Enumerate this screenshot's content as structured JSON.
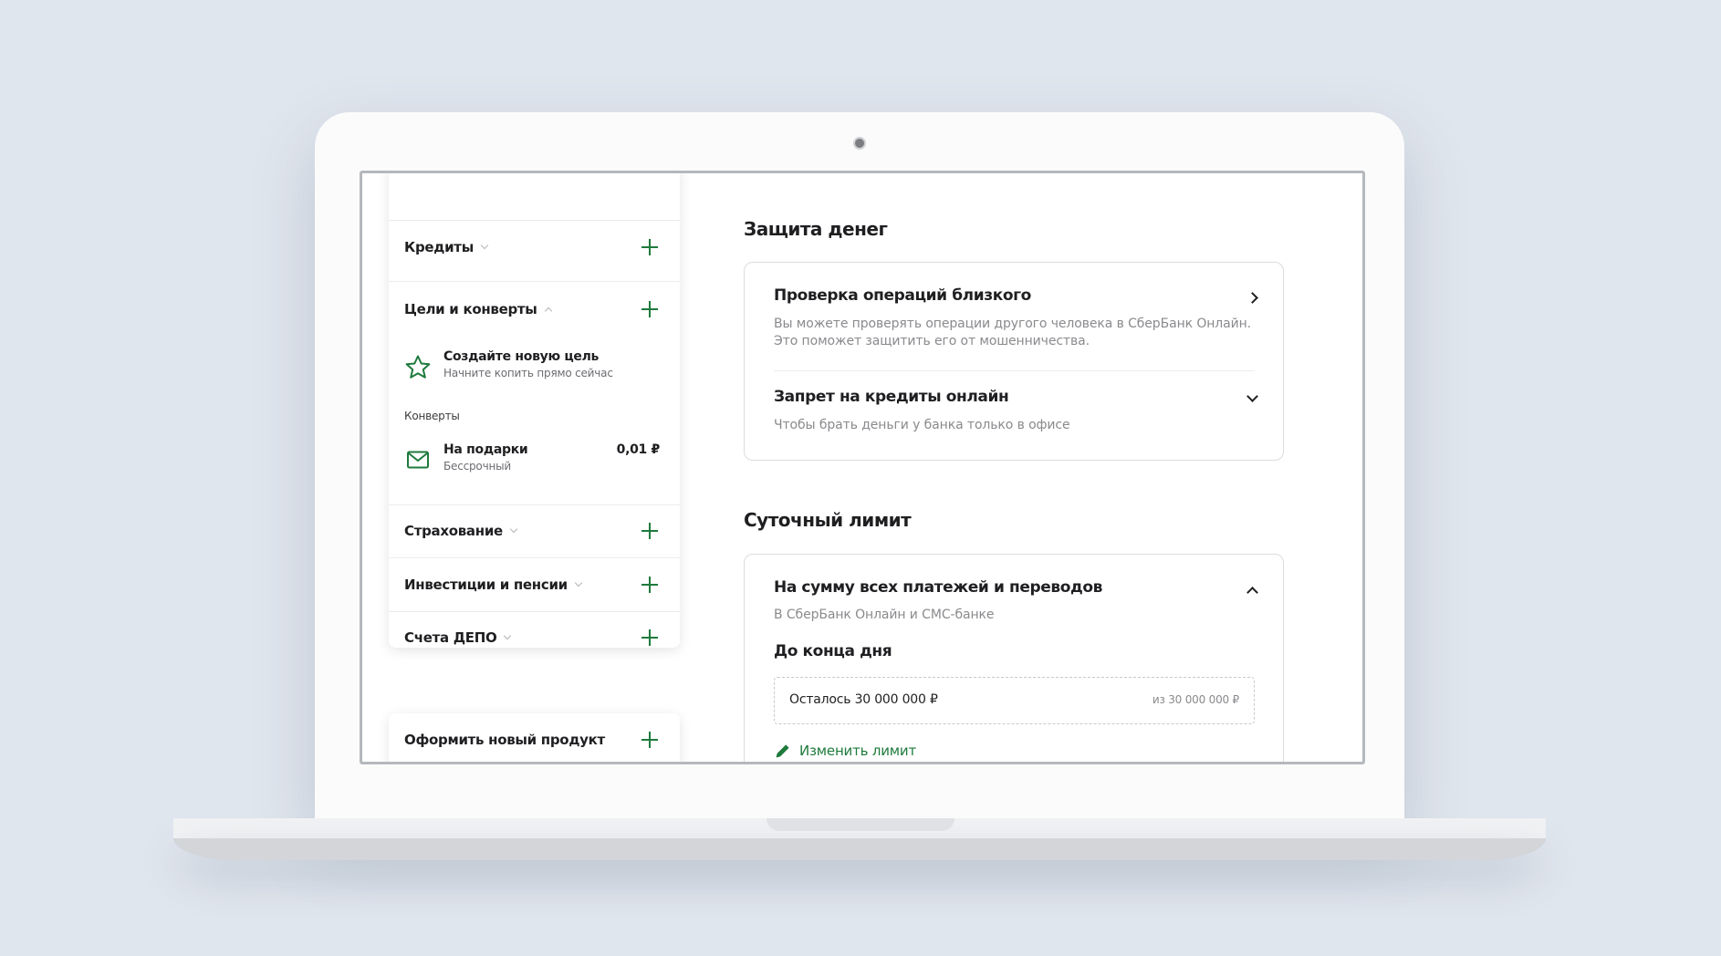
{
  "sidebar": {
    "credits": {
      "label": "Кредиты"
    },
    "goals": {
      "label": "Цели и конверты",
      "new_goal_title": "Создайте новую цель",
      "new_goal_subtitle": "Начните копить прямо сейчас",
      "envelopes_label": "Конверты",
      "envelope": {
        "title": "На подарки",
        "subtitle": "Бессрочный",
        "amount": "0,01 ₽"
      }
    },
    "insurance": {
      "label": "Страхование"
    },
    "investments": {
      "label": "Инвестиции и пенсии"
    },
    "depo": {
      "label": "Счета ДЕПО"
    },
    "new_product": {
      "label": "Оформить новый продукт"
    }
  },
  "protection": {
    "heading": "Защита денег",
    "check": {
      "title": "Проверка операций близкого",
      "description": "Вы можете проверять операции другого человека в СберБанк Онлайн. Это поможет защитить его от мошенничества."
    },
    "credit_ban": {
      "title": "Запрет на кредиты онлайн",
      "description": "Чтобы брать деньги у банка только в офисе"
    }
  },
  "daily_limit": {
    "heading": "Суточный лимит",
    "title": "На сумму всех платежей и переводов",
    "subtitle": "В СберБанк Онлайн и СМС-банке",
    "period_label": "До конца дня",
    "remaining": "Осталось 30 000 000 ₽",
    "total": "из 30 000 000 ₽",
    "edit_label": "Изменить лимит"
  },
  "colors": {
    "accent": "#1e7a3c",
    "background": "#e0e6ee"
  }
}
